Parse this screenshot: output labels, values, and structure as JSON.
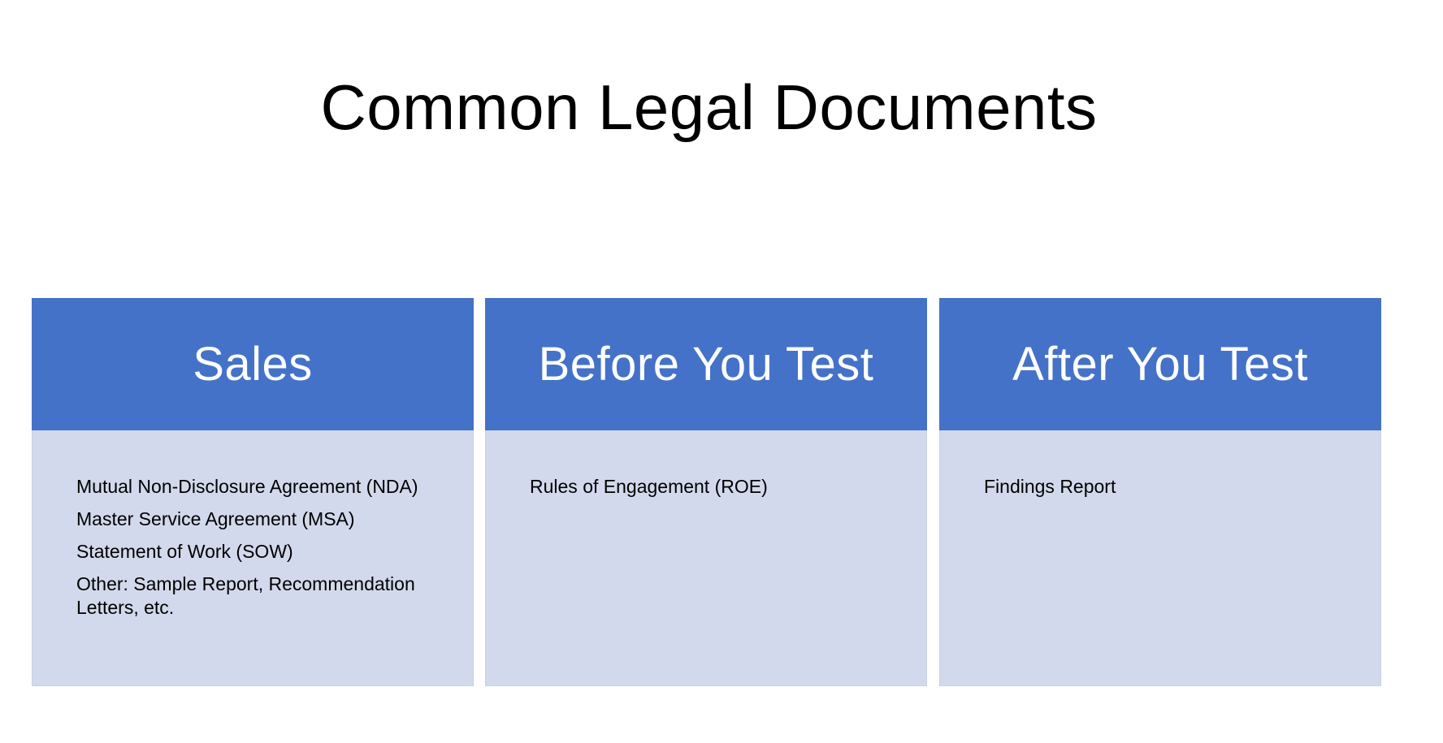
{
  "slide": {
    "title": "Common Legal Documents",
    "columns": [
      {
        "heading": "Sales",
        "items": [
          "Mutual Non-Disclosure Agreement (NDA)",
          "Master Service Agreement (MSA)",
          "Statement of Work (SOW)",
          "Other: Sample Report, Recommendation Letters, etc."
        ]
      },
      {
        "heading": "Before You Test",
        "items": [
          "Rules of Engagement (ROE)"
        ]
      },
      {
        "heading": "After You Test",
        "items": [
          "Findings Report"
        ]
      }
    ]
  },
  "colors": {
    "header_blue": "#4472C8",
    "body_light_blue": "#D2D9EC"
  }
}
